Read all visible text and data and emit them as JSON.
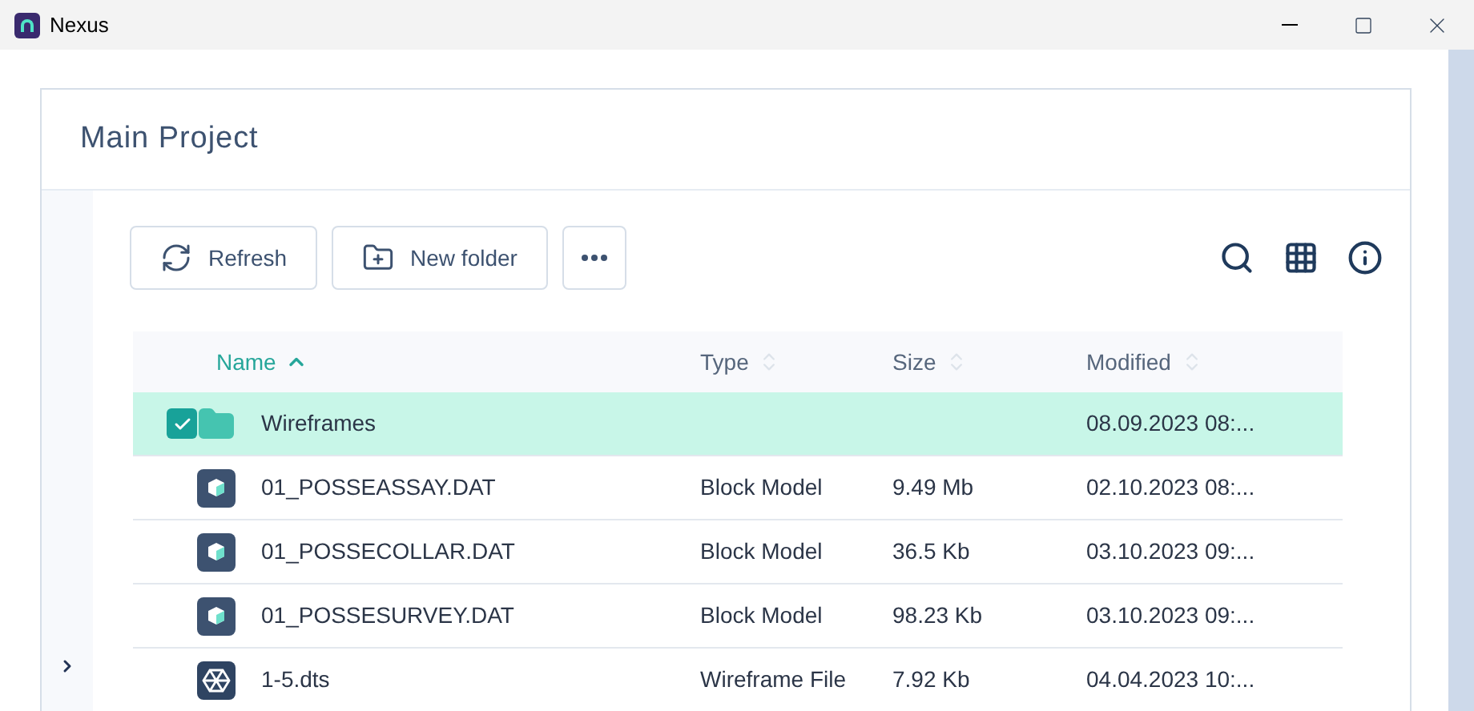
{
  "window": {
    "title": "Nexus"
  },
  "project": {
    "title": "Main Project"
  },
  "toolbar": {
    "buttons": [
      {
        "kind": "refresh",
        "label": "Refresh"
      },
      {
        "kind": "new_folder",
        "label": "New folder"
      },
      {
        "kind": "more"
      }
    ]
  },
  "table": {
    "columns": [
      {
        "label": "Name",
        "sorted": true
      },
      {
        "label": "Type",
        "sorted": false
      },
      {
        "label": "Size",
        "sorted": false
      },
      {
        "label": "Modified",
        "sorted": false
      }
    ],
    "rows": [
      {
        "kind": "folder",
        "selected": true,
        "name": "Wireframes",
        "type": "",
        "size": "",
        "modified": "08.09.2023 08:..."
      },
      {
        "kind": "block_model",
        "selected": false,
        "name": "01_POSSEASSAY.DAT",
        "type": "Block Model",
        "size": "9.49 Mb",
        "modified": "02.10.2023 08:..."
      },
      {
        "kind": "block_model",
        "selected": false,
        "name": "01_POSSECOLLAR.DAT",
        "type": "Block Model",
        "size": "36.5 Kb",
        "modified": "03.10.2023 09:..."
      },
      {
        "kind": "block_model",
        "selected": false,
        "name": "01_POSSESURVEY.DAT",
        "type": "Block Model",
        "size": "98.23 Kb",
        "modified": "03.10.2023 09:..."
      },
      {
        "kind": "wireframe",
        "selected": false,
        "name": "1-5.dts",
        "type": "Wireframe File",
        "size": "7.92 Kb",
        "modified": "04.04.2023 10:..."
      }
    ]
  }
}
